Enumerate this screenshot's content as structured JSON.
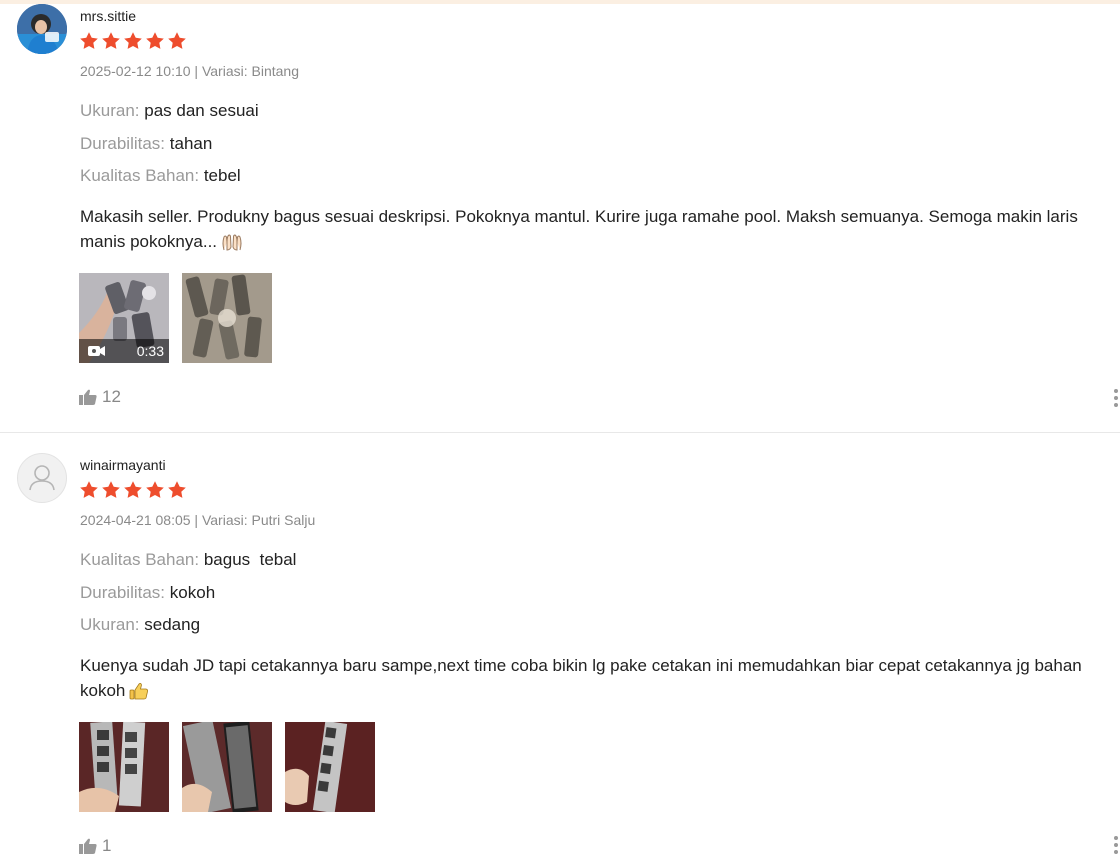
{
  "reviews": [
    {
      "username": "mrs.sittie",
      "rating": 5,
      "date": "2025-02-12 10:10",
      "variation": "Variasi: Bintang",
      "attributes": [
        {
          "label": "Ukuran:",
          "value": "pas dan sesuai"
        },
        {
          "label": "Durabilitas:",
          "value": "tahan"
        },
        {
          "label": "Kualitas Bahan:",
          "value": "tebel"
        }
      ],
      "comment": "Makasih seller. Produkny bagus sesuai deskripsi. Pokoknya mantul. Kurire juga ramahe pool. Maksh semuanya. Semoga makin laris manis pokoknya...",
      "comment_emoji": "raised-hands-emoji",
      "media": [
        {
          "type": "video",
          "duration": "0:33"
        },
        {
          "type": "image"
        }
      ],
      "likes": "12"
    },
    {
      "username": "winairmayanti",
      "rating": 5,
      "date": "2024-04-21 08:05",
      "variation": "Variasi: Putri Salju",
      "attributes": [
        {
          "label": "Kualitas Bahan:",
          "value": "bagus  tebal"
        },
        {
          "label": "Durabilitas:",
          "value": "kokoh"
        },
        {
          "label": "Ukuran:",
          "value": "sedang"
        }
      ],
      "comment": "Kuenya sudah JD tapi cetakannya baru sampe,next time coba bikin lg pake cetakan ini memudahkan biar cepat cetakannya jg bahan kokoh",
      "comment_emoji": "thumbs-up-emoji",
      "media": [
        {
          "type": "image"
        },
        {
          "type": "image"
        },
        {
          "type": "image"
        }
      ],
      "likes": "1"
    }
  ],
  "colors": {
    "star": "#ee4d2d",
    "muted_text": "#8a8a8a",
    "label_text": "#9a9a9a",
    "divider": "#e8e8e8"
  },
  "icons": {
    "star": "star-icon",
    "like": "thumbs-up-icon",
    "video": "video-camera-icon",
    "more": "more-vertical-icon",
    "default_avatar": "user-icon"
  }
}
